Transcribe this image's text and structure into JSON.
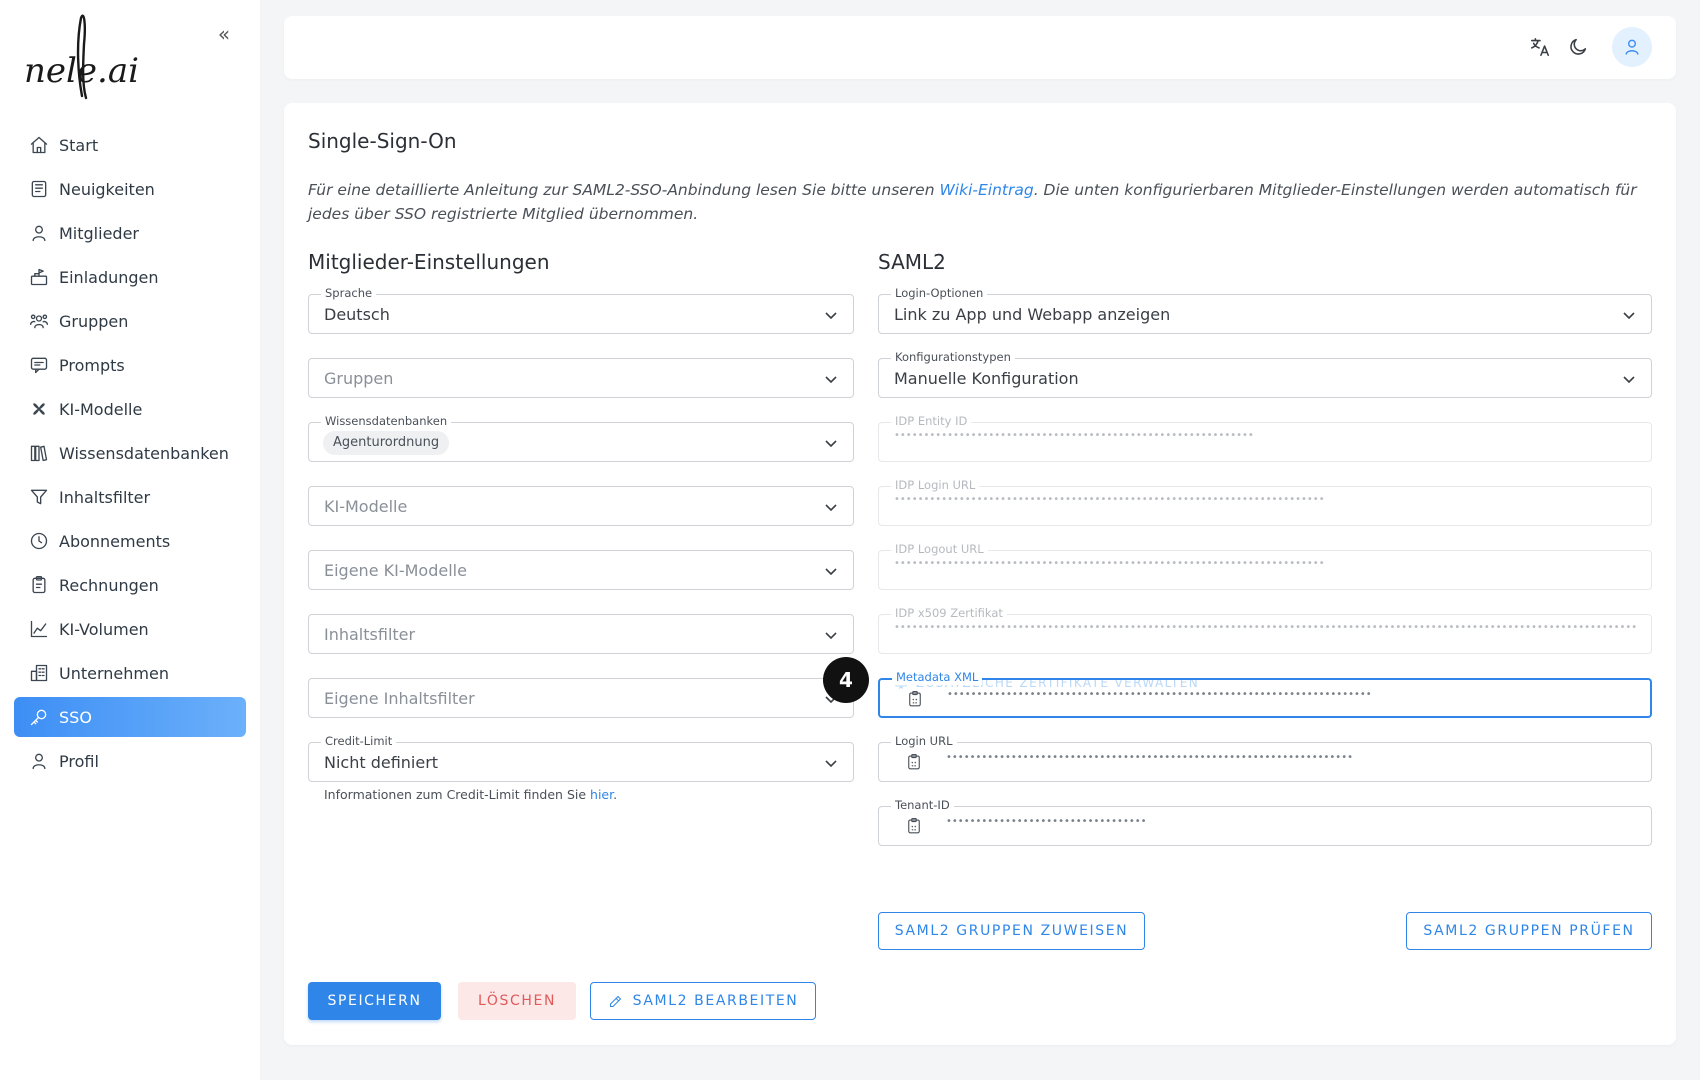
{
  "app": {
    "logo_text": "nele.ai"
  },
  "sidebar": {
    "items": [
      {
        "label": "Start",
        "icon": "home-icon"
      },
      {
        "label": "Neuigkeiten",
        "icon": "news-icon"
      },
      {
        "label": "Mitglieder",
        "icon": "user-icon"
      },
      {
        "label": "Einladungen",
        "icon": "invite-icon"
      },
      {
        "label": "Gruppen",
        "icon": "group-icon"
      },
      {
        "label": "Prompts",
        "icon": "prompt-icon"
      },
      {
        "label": "KI-Modelle",
        "icon": "model-icon"
      },
      {
        "label": "Wissensdatenbanken",
        "icon": "library-icon"
      },
      {
        "label": "Inhaltsfilter",
        "icon": "filter-icon"
      },
      {
        "label": "Abonnements",
        "icon": "clock-icon"
      },
      {
        "label": "Rechnungen",
        "icon": "invoice-icon"
      },
      {
        "label": "KI-Volumen",
        "icon": "chart-icon"
      },
      {
        "label": "Unternehmen",
        "icon": "building-icon"
      },
      {
        "label": "SSO",
        "icon": "key-icon",
        "active": true
      },
      {
        "label": "Profil",
        "icon": "user-icon"
      }
    ]
  },
  "page": {
    "title": "Single-Sign-On",
    "intro_before": "Für eine detaillierte Anleitung zur SAML2-SSO-Anbindung lesen Sie bitte unseren ",
    "intro_link": "Wiki-Eintrag",
    "intro_after": ". Die unten konfigurierbaren Mitglieder-Einstellungen werden automatisch für jedes über SSO registrierte Mitglied übernommen."
  },
  "members": {
    "title": "Mitglieder-Einstellungen",
    "sprache": {
      "label": "Sprache",
      "value": "Deutsch"
    },
    "gruppen": {
      "placeholder": "Gruppen"
    },
    "wissen": {
      "label": "Wissensdatenbanken",
      "chip": "Agenturordnung"
    },
    "ki_modelle": {
      "placeholder": "KI-Modelle"
    },
    "eigene_ki": {
      "placeholder": "Eigene KI-Modelle"
    },
    "inhaltsfilter": {
      "placeholder": "Inhaltsfilter"
    },
    "eigene_filter": {
      "placeholder": "Eigene Inhaltsfilter"
    },
    "credit": {
      "label": "Credit-Limit",
      "value": "Nicht definiert"
    },
    "credit_help_before": "Informationen zum Credit-Limit finden Sie ",
    "credit_help_link": "hier",
    "credit_help_after": "."
  },
  "saml": {
    "title": "SAML2",
    "login_options": {
      "label": "Login-Optionen",
      "value": "Link zu App und Webapp anzeigen"
    },
    "config_types": {
      "label": "Konfigurationstypen",
      "value": "Manuelle Konfiguration"
    },
    "idp_entity": {
      "label": "IDP Entity ID",
      "masked": "•••••••••••••••••••••••••••••••••••••••••••••••••••••••••••••"
    },
    "idp_login": {
      "label": "IDP Login URL",
      "masked": "•••••••••••••••••••••••••••••••••••••••••••••••••••••••••••••••••••••••••"
    },
    "idp_logout": {
      "label": "IDP Logout URL",
      "masked": "•••••••••••••••••••••••••••••••••••••••••••••••••••••••••••••••••••••••••"
    },
    "idp_cert": {
      "label": "IDP x509 Zertifikat",
      "masked": "•••••••••••••••••••••••••••••••••••••••••••••••••••••••••••••••••••••••••••••••••••••••••••••••••••••••••••••••••••••••••••••••••••••••••"
    },
    "extra_certs": "ZUSÄTZLICHE ZERTIFIKATE VERWALTEN",
    "metadata": {
      "label": "Metadata XML",
      "masked": "••••••••••••••••••••••••••••••••••••••••••••••••••••••••••••••••••••••••"
    },
    "login_url": {
      "label": "Login URL",
      "masked": "•••••••••••••••••••••••••••••••••••••••••••••••••••••••••••••••••••••"
    },
    "tenant": {
      "label": "Tenant-ID",
      "masked": "••••••••••••••••••••••••••••••••••"
    },
    "assign_groups": "SAML2 GRUPPEN ZUWEISEN",
    "check_groups": "SAML2 GRUPPEN PRÜFEN"
  },
  "actions": {
    "save": "SPEICHERN",
    "delete": "LÖSCHEN",
    "edit": "SAML2 BEARBEITEN"
  },
  "marker": "4",
  "colors": {
    "accent": "#2f86e8",
    "danger": "#e05a5a",
    "active_nav": "#4f9bf7"
  }
}
